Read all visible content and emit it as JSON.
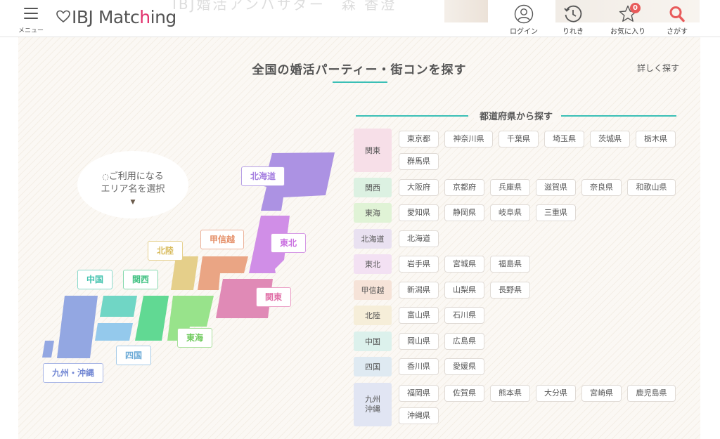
{
  "header": {
    "menu_label": "メニュー",
    "logo_text_a": "IBJ Matc",
    "logo_text_b": "h",
    "logo_text_c": "ing",
    "ambassador_text": "IBJ婚活アンバサダー　森 香澄",
    "nav": [
      {
        "label": "ログイン",
        "icon": "user-icon"
      },
      {
        "label": "りれき",
        "icon": "history-icon"
      },
      {
        "label": "お気に入り",
        "icon": "star-icon",
        "badge": "0"
      },
      {
        "label": "さがす",
        "icon": "search-icon"
      }
    ],
    "accent_color": "#e85a5a",
    "search_color": "#e85a5a"
  },
  "main": {
    "title": "全国の婚活パーティー・街コンを探す",
    "detail_link": "詳しく探す",
    "bubble_line1": "ご利用になる",
    "bubble_line2": "エリア名を選択",
    "regions_on_map": {
      "hokkaido": "北海道",
      "tohoku": "東北",
      "koshinetsu": "甲信越",
      "kanto": "関東",
      "hokuriku": "北陸",
      "chugoku": "中国",
      "kansai": "関西",
      "shikoku": "四国",
      "tokai": "東海",
      "kyushu": "九州・沖縄"
    },
    "pref_heading": "都道府県から探す",
    "accent_color": "#3bbfb6",
    "prefecture_groups": [
      {
        "region": "関東",
        "color": "#f7dfe8",
        "prefs": [
          "東京都",
          "神奈川県",
          "千葉県",
          "埼玉県",
          "茨城県",
          "栃木県",
          "群馬県"
        ]
      },
      {
        "region": "関西",
        "color": "#dcf1e2",
        "prefs": [
          "大阪府",
          "京都府",
          "兵庫県",
          "滋賀県",
          "奈良県",
          "和歌山県"
        ]
      },
      {
        "region": "東海",
        "color": "#e0f3d6",
        "prefs": [
          "愛知県",
          "静岡県",
          "岐阜県",
          "三重県"
        ]
      },
      {
        "region": "北海道",
        "color": "#e9e1f1",
        "prefs": [
          "北海道"
        ]
      },
      {
        "region": "東北",
        "color": "#f3e1f3",
        "prefs": [
          "岩手県",
          "宮城県",
          "福島県"
        ]
      },
      {
        "region": "甲信越",
        "color": "#f6e3d8",
        "prefs": [
          "新潟県",
          "山梨県",
          "長野県"
        ]
      },
      {
        "region": "北陸",
        "color": "#f6eed9",
        "prefs": [
          "富山県",
          "石川県"
        ]
      },
      {
        "region": "中国",
        "color": "#dcf1ec",
        "prefs": [
          "岡山県",
          "広島県"
        ]
      },
      {
        "region": "四国",
        "color": "#dfeaf2",
        "prefs": [
          "香川県",
          "愛媛県"
        ]
      },
      {
        "region": "九州\n沖縄",
        "color": "#e1e5f3",
        "prefs": [
          "福岡県",
          "佐賀県",
          "熊本県",
          "大分県",
          "宮崎県",
          "鹿児島県",
          "沖縄県"
        ]
      }
    ]
  }
}
